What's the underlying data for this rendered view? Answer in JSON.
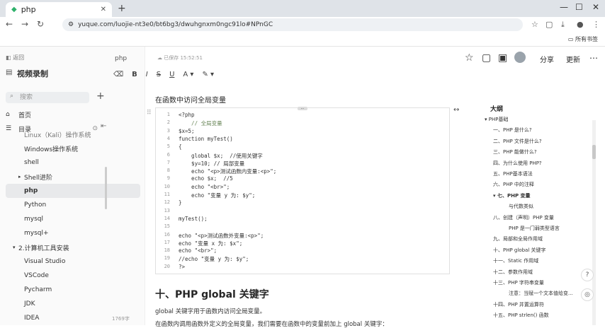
{
  "browser": {
    "tab_title": "php",
    "url": "yuque.com/luojie-nt3e0/bt6bg3/dwuhgnxm0ngc91lo#NPnGC",
    "all_bookmarks": "所有书签"
  },
  "sidebar": {
    "back_label": "返回",
    "title": "视频录制",
    "search_placeholder": "搜索",
    "home": "首页",
    "toc": "目录",
    "items": [
      {
        "label": "Linux（Kali）操作系统"
      },
      {
        "label": "Windows操作系统"
      },
      {
        "label": "shell"
      },
      {
        "label": "Shell进阶"
      },
      {
        "label": "php"
      },
      {
        "label": "Python"
      },
      {
        "label": "mysql"
      },
      {
        "label": "mysql+"
      },
      {
        "label": "2.计算机工具安装"
      },
      {
        "label": "Visual Studio"
      },
      {
        "label": "VSCode"
      },
      {
        "label": "Pycharm"
      },
      {
        "label": "JDK"
      },
      {
        "label": "IDEA"
      }
    ],
    "word_count": "1769字"
  },
  "header": {
    "crumb": "php",
    "saved": "已保存 15:52:51",
    "share": "分享",
    "more": "更新"
  },
  "content": {
    "access_heading": "在函数中访问全局变量",
    "code_lines": [
      {
        "n": "1",
        "t": "<?php",
        "c": false
      },
      {
        "n": "2",
        "t": "    // 全局变量",
        "c": true
      },
      {
        "n": "3",
        "t": "$x=5;",
        "c": false
      },
      {
        "n": "4",
        "t": "function myTest()",
        "c": false
      },
      {
        "n": "5",
        "t": "{",
        "c": false
      },
      {
        "n": "6",
        "t": "    global $x;  //使用关键字",
        "c": false
      },
      {
        "n": "7",
        "t": "    $y=10; // 局部变量",
        "c": false
      },
      {
        "n": "8",
        "t": "    echo \"<p>测试函数内变量:<p>\";",
        "c": false
      },
      {
        "n": "9",
        "t": "    echo $x;  //5",
        "c": false
      },
      {
        "n": "10",
        "t": "    echo \"<br>\";",
        "c": false
      },
      {
        "n": "11",
        "t": "    echo \"变量 y 为: $y\";",
        "c": false
      },
      {
        "n": "12",
        "t": "}",
        "c": false
      },
      {
        "n": "13",
        "t": "",
        "c": false
      },
      {
        "n": "14",
        "t": "myTest();",
        "c": false
      },
      {
        "n": "15",
        "t": "",
        "c": false
      },
      {
        "n": "16",
        "t": "echo \"<p>测试函数外变量:<p>\";",
        "c": false
      },
      {
        "n": "17",
        "t": "echo \"变量 x 为: $x\";",
        "c": false
      },
      {
        "n": "18",
        "t": "echo \"<br>\";",
        "c": false
      },
      {
        "n": "19",
        "t": "//echo \"变量 y 为: $y\";",
        "c": false
      },
      {
        "n": "20",
        "t": "?>",
        "c": false
      }
    ],
    "h2": "十、PHP global 关键字",
    "para1": "global 关键字用于函数内访问全局变量。",
    "para2": "在函数内调用函数外定义的全局变量，我们需要在函数中的变量前加上 global 关键字："
  },
  "outline": {
    "title": "大纲",
    "items": [
      {
        "label": "PHP基础",
        "indent": 0,
        "active": false
      },
      {
        "label": "一、PHP 是什么?",
        "indent": 1,
        "active": false
      },
      {
        "label": "二、PHP 文件是什么?",
        "indent": 1,
        "active": false
      },
      {
        "label": "三、PHP 能做什么?",
        "indent": 1,
        "active": false
      },
      {
        "label": "四、为什么使用 PHP?",
        "indent": 1,
        "active": false
      },
      {
        "label": "五、PHP基本语法",
        "indent": 1,
        "active": false
      },
      {
        "label": "六、PHP 中的注释",
        "indent": 1,
        "active": false
      },
      {
        "label": "七、PHP 变量",
        "indent": 1,
        "active": true
      },
      {
        "label": "与代数类似",
        "indent": 2,
        "active": false
      },
      {
        "label": "八、创建（声明）PHP 变量",
        "indent": 1,
        "active": false
      },
      {
        "label": "PHP 是一门弱类型语言",
        "indent": 2,
        "active": false
      },
      {
        "label": "九、局部和全局作用域",
        "indent": 1,
        "active": false
      },
      {
        "label": "十、PHP global 关键字",
        "indent": 1,
        "active": false
      },
      {
        "label": "十一、Static 作用域",
        "indent": 1,
        "active": false
      },
      {
        "label": "十二、参数作用域",
        "indent": 1,
        "active": false
      },
      {
        "label": "十三、PHP 字符串变量",
        "indent": 1,
        "active": false
      },
      {
        "label": "注意：当赋一个文本值给变...",
        "indent": 2,
        "active": false
      },
      {
        "label": "十四、PHP 并置运算符",
        "indent": 1,
        "active": false
      },
      {
        "label": "十五、PHP strlen() 函数",
        "indent": 1,
        "active": false
      }
    ]
  }
}
